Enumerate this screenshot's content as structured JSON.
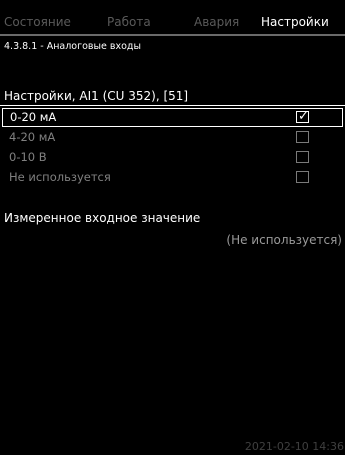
{
  "tabs": [
    {
      "label": "Состояние",
      "active": false
    },
    {
      "label": "Работа",
      "active": false
    },
    {
      "label": "Авария",
      "active": false
    },
    {
      "label": "Настройки",
      "active": true
    }
  ],
  "breadcrumb": "4.3.8.1 - Аналоговые входы",
  "section_title": "Настройки, AI1 (CU 352), [51]",
  "options": [
    {
      "label": "0-20 мА",
      "checked": true,
      "selected": true
    },
    {
      "label": "4-20 мА",
      "checked": false,
      "selected": false
    },
    {
      "label": "0-10 В",
      "checked": false,
      "selected": false
    },
    {
      "label": "Не используется",
      "checked": false,
      "selected": false
    }
  ],
  "measured": {
    "label": "Измеренное входное значение",
    "value": "(Не используется)"
  },
  "timestamp": "2021-02-10 14:36",
  "colors": {
    "background": "#000000",
    "text": "#ffffff",
    "inactive": "#5a5a5a"
  },
  "icons": {
    "checkmark": "✓"
  }
}
